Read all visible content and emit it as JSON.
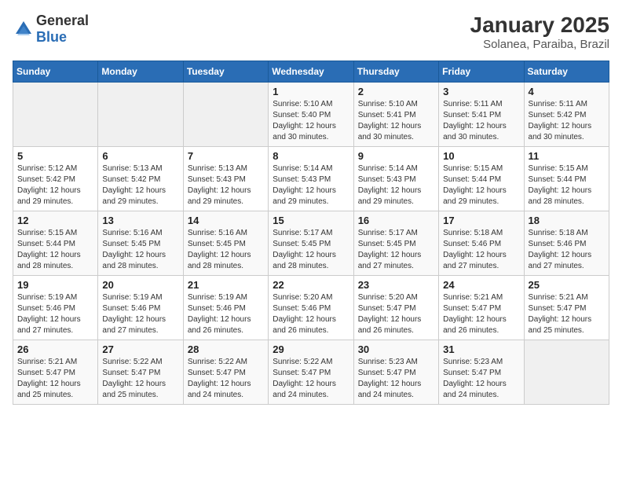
{
  "header": {
    "logo_general": "General",
    "logo_blue": "Blue",
    "title": "January 2025",
    "subtitle": "Solanea, Paraiba, Brazil"
  },
  "days_of_week": [
    "Sunday",
    "Monday",
    "Tuesday",
    "Wednesday",
    "Thursday",
    "Friday",
    "Saturday"
  ],
  "weeks": [
    [
      {
        "day": "",
        "info": ""
      },
      {
        "day": "",
        "info": ""
      },
      {
        "day": "",
        "info": ""
      },
      {
        "day": "1",
        "info": "Sunrise: 5:10 AM\nSunset: 5:40 PM\nDaylight: 12 hours and 30 minutes."
      },
      {
        "day": "2",
        "info": "Sunrise: 5:10 AM\nSunset: 5:41 PM\nDaylight: 12 hours and 30 minutes."
      },
      {
        "day": "3",
        "info": "Sunrise: 5:11 AM\nSunset: 5:41 PM\nDaylight: 12 hours and 30 minutes."
      },
      {
        "day": "4",
        "info": "Sunrise: 5:11 AM\nSunset: 5:42 PM\nDaylight: 12 hours and 30 minutes."
      }
    ],
    [
      {
        "day": "5",
        "info": "Sunrise: 5:12 AM\nSunset: 5:42 PM\nDaylight: 12 hours and 29 minutes."
      },
      {
        "day": "6",
        "info": "Sunrise: 5:13 AM\nSunset: 5:42 PM\nDaylight: 12 hours and 29 minutes."
      },
      {
        "day": "7",
        "info": "Sunrise: 5:13 AM\nSunset: 5:43 PM\nDaylight: 12 hours and 29 minutes."
      },
      {
        "day": "8",
        "info": "Sunrise: 5:14 AM\nSunset: 5:43 PM\nDaylight: 12 hours and 29 minutes."
      },
      {
        "day": "9",
        "info": "Sunrise: 5:14 AM\nSunset: 5:43 PM\nDaylight: 12 hours and 29 minutes."
      },
      {
        "day": "10",
        "info": "Sunrise: 5:15 AM\nSunset: 5:44 PM\nDaylight: 12 hours and 29 minutes."
      },
      {
        "day": "11",
        "info": "Sunrise: 5:15 AM\nSunset: 5:44 PM\nDaylight: 12 hours and 28 minutes."
      }
    ],
    [
      {
        "day": "12",
        "info": "Sunrise: 5:15 AM\nSunset: 5:44 PM\nDaylight: 12 hours and 28 minutes."
      },
      {
        "day": "13",
        "info": "Sunrise: 5:16 AM\nSunset: 5:45 PM\nDaylight: 12 hours and 28 minutes."
      },
      {
        "day": "14",
        "info": "Sunrise: 5:16 AM\nSunset: 5:45 PM\nDaylight: 12 hours and 28 minutes."
      },
      {
        "day": "15",
        "info": "Sunrise: 5:17 AM\nSunset: 5:45 PM\nDaylight: 12 hours and 28 minutes."
      },
      {
        "day": "16",
        "info": "Sunrise: 5:17 AM\nSunset: 5:45 PM\nDaylight: 12 hours and 27 minutes."
      },
      {
        "day": "17",
        "info": "Sunrise: 5:18 AM\nSunset: 5:46 PM\nDaylight: 12 hours and 27 minutes."
      },
      {
        "day": "18",
        "info": "Sunrise: 5:18 AM\nSunset: 5:46 PM\nDaylight: 12 hours and 27 minutes."
      }
    ],
    [
      {
        "day": "19",
        "info": "Sunrise: 5:19 AM\nSunset: 5:46 PM\nDaylight: 12 hours and 27 minutes."
      },
      {
        "day": "20",
        "info": "Sunrise: 5:19 AM\nSunset: 5:46 PM\nDaylight: 12 hours and 27 minutes."
      },
      {
        "day": "21",
        "info": "Sunrise: 5:19 AM\nSunset: 5:46 PM\nDaylight: 12 hours and 26 minutes."
      },
      {
        "day": "22",
        "info": "Sunrise: 5:20 AM\nSunset: 5:46 PM\nDaylight: 12 hours and 26 minutes."
      },
      {
        "day": "23",
        "info": "Sunrise: 5:20 AM\nSunset: 5:47 PM\nDaylight: 12 hours and 26 minutes."
      },
      {
        "day": "24",
        "info": "Sunrise: 5:21 AM\nSunset: 5:47 PM\nDaylight: 12 hours and 26 minutes."
      },
      {
        "day": "25",
        "info": "Sunrise: 5:21 AM\nSunset: 5:47 PM\nDaylight: 12 hours and 25 minutes."
      }
    ],
    [
      {
        "day": "26",
        "info": "Sunrise: 5:21 AM\nSunset: 5:47 PM\nDaylight: 12 hours and 25 minutes."
      },
      {
        "day": "27",
        "info": "Sunrise: 5:22 AM\nSunset: 5:47 PM\nDaylight: 12 hours and 25 minutes."
      },
      {
        "day": "28",
        "info": "Sunrise: 5:22 AM\nSunset: 5:47 PM\nDaylight: 12 hours and 24 minutes."
      },
      {
        "day": "29",
        "info": "Sunrise: 5:22 AM\nSunset: 5:47 PM\nDaylight: 12 hours and 24 minutes."
      },
      {
        "day": "30",
        "info": "Sunrise: 5:23 AM\nSunset: 5:47 PM\nDaylight: 12 hours and 24 minutes."
      },
      {
        "day": "31",
        "info": "Sunrise: 5:23 AM\nSunset: 5:47 PM\nDaylight: 12 hours and 24 minutes."
      },
      {
        "day": "",
        "info": ""
      }
    ]
  ]
}
